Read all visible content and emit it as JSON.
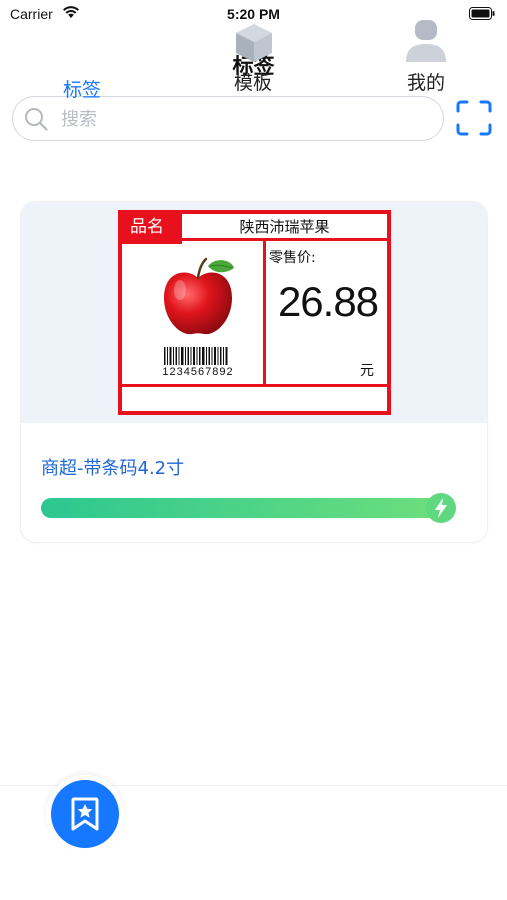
{
  "status_bar": {
    "carrier": "Carrier",
    "time": "5:20 PM"
  },
  "nav": {
    "title": "标签"
  },
  "search": {
    "placeholder": "搜索"
  },
  "card": {
    "label": {
      "product_name_header": "品名",
      "product_name": "陕西沛瑞苹果",
      "barcode_number": "1234567892",
      "price_label": "零售价:",
      "price": "26.88",
      "price_unit": "元"
    },
    "title": "商超-带条码4.2寸",
    "progress": 1.0
  },
  "tabs": [
    {
      "label": "标签",
      "icon": "label-star-icon",
      "active": true
    },
    {
      "label": "模板",
      "icon": "cube-icon",
      "active": false
    },
    {
      "label": "我的",
      "icon": "person-icon",
      "active": false
    }
  ],
  "colors": {
    "accent": "#1677ff",
    "label_red": "#e8101d",
    "progress_start": "#2cc791",
    "progress_end": "#6fdf7c"
  }
}
